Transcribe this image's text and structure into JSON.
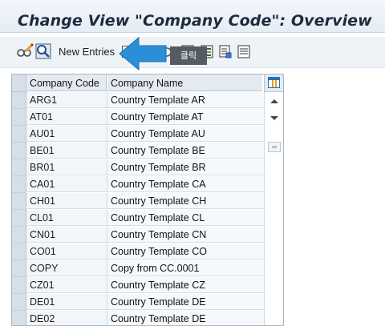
{
  "header": {
    "title": "Change View \"Company Code\": Overview"
  },
  "toolbar": {
    "display_change_icon": "glasses-pencil-icon",
    "find_icon": "magnifier-icon",
    "new_entries_label": "New Entries",
    "callout_label": "클릭",
    "icons": [
      "copy-icon",
      "delete-icon",
      "undo-icon",
      "select-all-icon",
      "deselect-icon",
      "select-block-icon",
      "print-icon",
      "details-icon"
    ]
  },
  "table": {
    "columns": [
      "Company Code",
      "Company Name"
    ],
    "rows": [
      {
        "code": "ARG1",
        "name": "Country Template AR"
      },
      {
        "code": "AT01",
        "name": "Country Template AT"
      },
      {
        "code": "AU01",
        "name": "Country Template AU"
      },
      {
        "code": "BE01",
        "name": "Country Template BE"
      },
      {
        "code": "BR01",
        "name": "Country Template BR"
      },
      {
        "code": "CA01",
        "name": "Country Template CA"
      },
      {
        "code": "CH01",
        "name": "Country Template CH"
      },
      {
        "code": "CL01",
        "name": "Country Template CL"
      },
      {
        "code": "CN01",
        "name": "Country Template CN"
      },
      {
        "code": "CO01",
        "name": "Country Template CO"
      },
      {
        "code": "COPY",
        "name": "Copy from CC.0001"
      },
      {
        "code": "CZ01",
        "name": "Country Template CZ"
      },
      {
        "code": "DE01",
        "name": "Country Template DE"
      },
      {
        "code": "DE02",
        "name": "Country Template DE"
      }
    ]
  },
  "colors": {
    "arrow": "#2b8fd8",
    "title": "#1c2b3f",
    "callout_bg": "#555c63"
  }
}
